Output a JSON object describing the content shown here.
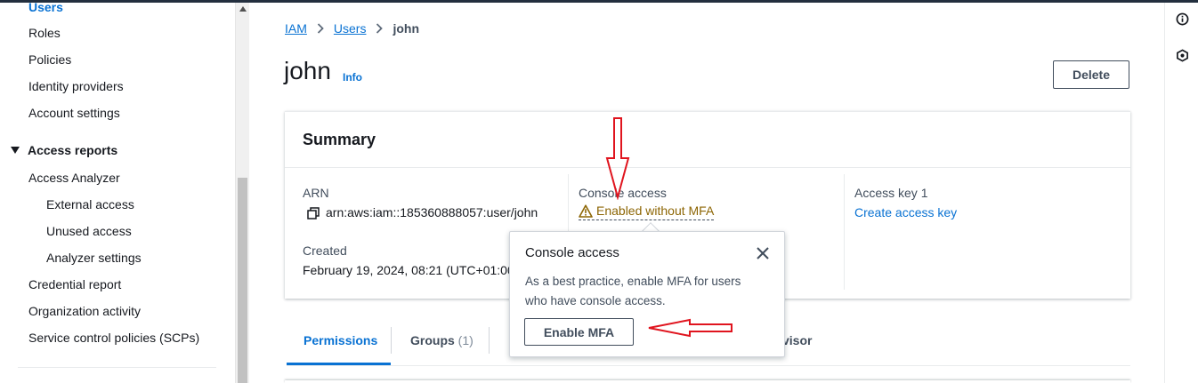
{
  "sidebar": {
    "items": [
      {
        "label": "Users",
        "active": true
      },
      {
        "label": "Roles"
      },
      {
        "label": "Policies"
      },
      {
        "label": "Identity providers"
      },
      {
        "label": "Account settings"
      }
    ],
    "section": {
      "label": "Access reports"
    },
    "report_items": [
      {
        "label": "Access Analyzer"
      },
      {
        "label": "External access",
        "sub": true
      },
      {
        "label": "Unused access",
        "sub": true
      },
      {
        "label": "Analyzer settings",
        "sub": true
      },
      {
        "label": "Credential report"
      },
      {
        "label": "Organization activity"
      },
      {
        "label": "Service control policies (SCPs)"
      }
    ]
  },
  "breadcrumb": {
    "items": [
      "IAM",
      "Users"
    ],
    "current": "john"
  },
  "page": {
    "title": "john",
    "info": "Info",
    "delete_label": "Delete"
  },
  "summary": {
    "title": "Summary",
    "arn_label": "ARN",
    "arn_value": "arn:aws:iam::185360888057:user/john",
    "created_label": "Created",
    "created_value": "February 19, 2024, 08:21 (UTC+01:00)",
    "console_label": "Console access",
    "console_value": "Enabled without MFA",
    "access_key_label": "Access key 1",
    "access_key_value": "Create access key"
  },
  "popover": {
    "title": "Console access",
    "body": "As a best practice, enable MFA for users who have console access.",
    "button_label": "Enable MFA"
  },
  "tabs": [
    {
      "label": "Permissions",
      "active": true
    },
    {
      "label": "Groups",
      "count": "(1)"
    },
    {
      "label": "visor"
    }
  ],
  "colors": {
    "link": "#0972d3",
    "warning": "#8d6605",
    "annotation": "#e0141e"
  },
  "icons": [
    "info-circle-icon",
    "hexagon-icon",
    "copy-icon",
    "warning-icon",
    "close-icon",
    "chevron-right-icon",
    "caret-down-icon"
  ]
}
